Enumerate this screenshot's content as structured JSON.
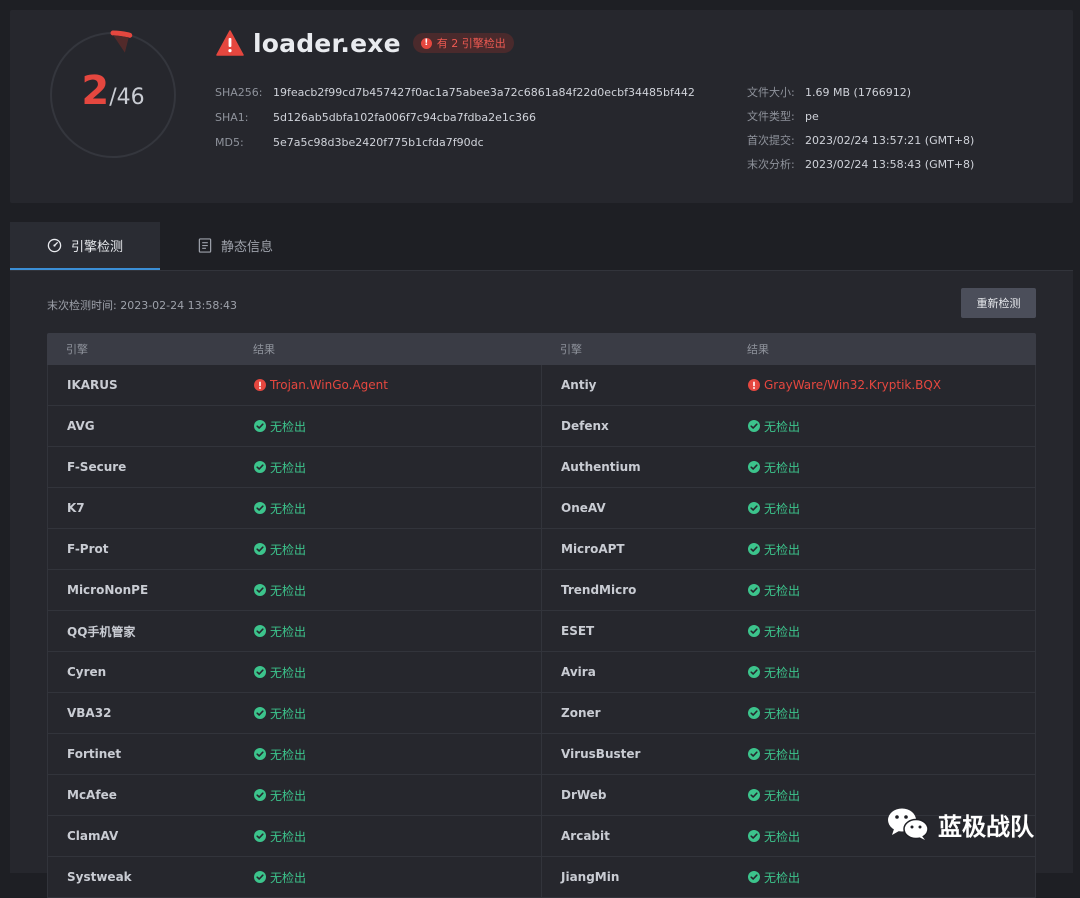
{
  "summary": {
    "detected": "2",
    "total": "/46",
    "detection_fraction": 0.0435,
    "file_name": "loader.exe",
    "badge_text": "有 2 引擎检出",
    "hashes": [
      {
        "label": "SHA256:",
        "value": "19feacb2f99cd7b457427f0ac1a75abee3a72c6861a84f22d0ecbf34485bf442"
      },
      {
        "label": "SHA1:",
        "value": "5d126ab5dbfa102fa006f7c94cba7fdba2e1c366"
      },
      {
        "label": "MD5:",
        "value": "5e7a5c98d3be2420f775b1cfda7f90dc"
      }
    ],
    "info": [
      {
        "label": "文件大小:",
        "value": "1.69 MB (1766912)"
      },
      {
        "label": "文件类型:",
        "value": "pe"
      },
      {
        "label": "首次提交:",
        "value": "2023/02/24 13:57:21 (GMT+8)"
      },
      {
        "label": "末次分析:",
        "value": "2023/02/24 13:58:43 (GMT+8)"
      }
    ]
  },
  "tabs": [
    {
      "label": "引擎检测",
      "icon": "gauge-icon",
      "active": true
    },
    {
      "label": "静态信息",
      "icon": "document-icon",
      "active": false
    }
  ],
  "scan": {
    "last_time": "末次检测时间: 2023-02-24 13:58:43",
    "rescan_label": "重新检测"
  },
  "table": {
    "headers": [
      "引擎",
      "结果",
      "引擎",
      "结果"
    ],
    "rows": [
      [
        {
          "engine": "IKARUS",
          "result": "Trojan.WinGo.Agent",
          "status": "bad"
        },
        {
          "engine": "Antiy",
          "result": "GrayWare/Win32.Kryptik.BQX",
          "status": "bad"
        }
      ],
      [
        {
          "engine": "AVG",
          "result": "无检出",
          "status": "ok"
        },
        {
          "engine": "Defenx",
          "result": "无检出",
          "status": "ok"
        }
      ],
      [
        {
          "engine": "F-Secure",
          "result": "无检出",
          "status": "ok"
        },
        {
          "engine": "Authentium",
          "result": "无检出",
          "status": "ok"
        }
      ],
      [
        {
          "engine": "K7",
          "result": "无检出",
          "status": "ok"
        },
        {
          "engine": "OneAV",
          "result": "无检出",
          "status": "ok"
        }
      ],
      [
        {
          "engine": "F-Prot",
          "result": "无检出",
          "status": "ok"
        },
        {
          "engine": "MicroAPT",
          "result": "无检出",
          "status": "ok"
        }
      ],
      [
        {
          "engine": "MicroNonPE",
          "result": "无检出",
          "status": "ok"
        },
        {
          "engine": "TrendMicro",
          "result": "无检出",
          "status": "ok"
        }
      ],
      [
        {
          "engine": "QQ手机管家",
          "result": "无检出",
          "status": "ok"
        },
        {
          "engine": "ESET",
          "result": "无检出",
          "status": "ok"
        }
      ],
      [
        {
          "engine": "Cyren",
          "result": "无检出",
          "status": "ok"
        },
        {
          "engine": "Avira",
          "result": "无检出",
          "status": "ok"
        }
      ],
      [
        {
          "engine": "VBA32",
          "result": "无检出",
          "status": "ok"
        },
        {
          "engine": "Zoner",
          "result": "无检出",
          "status": "ok"
        }
      ],
      [
        {
          "engine": "Fortinet",
          "result": "无检出",
          "status": "ok"
        },
        {
          "engine": "VirusBuster",
          "result": "无检出",
          "status": "ok"
        }
      ],
      [
        {
          "engine": "McAfee",
          "result": "无检出",
          "status": "ok"
        },
        {
          "engine": "DrWeb",
          "result": "无检出",
          "status": "ok"
        }
      ],
      [
        {
          "engine": "ClamAV",
          "result": "无检出",
          "status": "ok"
        },
        {
          "engine": "Arcabit",
          "result": "无检出",
          "status": "ok"
        }
      ],
      [
        {
          "engine": "Systweak",
          "result": "无检出",
          "status": "ok"
        },
        {
          "engine": "JiangMin",
          "result": "无检出",
          "status": "ok"
        }
      ]
    ]
  },
  "watermark": {
    "text": "蓝极战队",
    "icon": "wechat-icon"
  },
  "colors": {
    "danger": "#e5473f",
    "ok": "#3cc48c",
    "accent": "#3b8fd6",
    "background": "#1e1f24"
  }
}
